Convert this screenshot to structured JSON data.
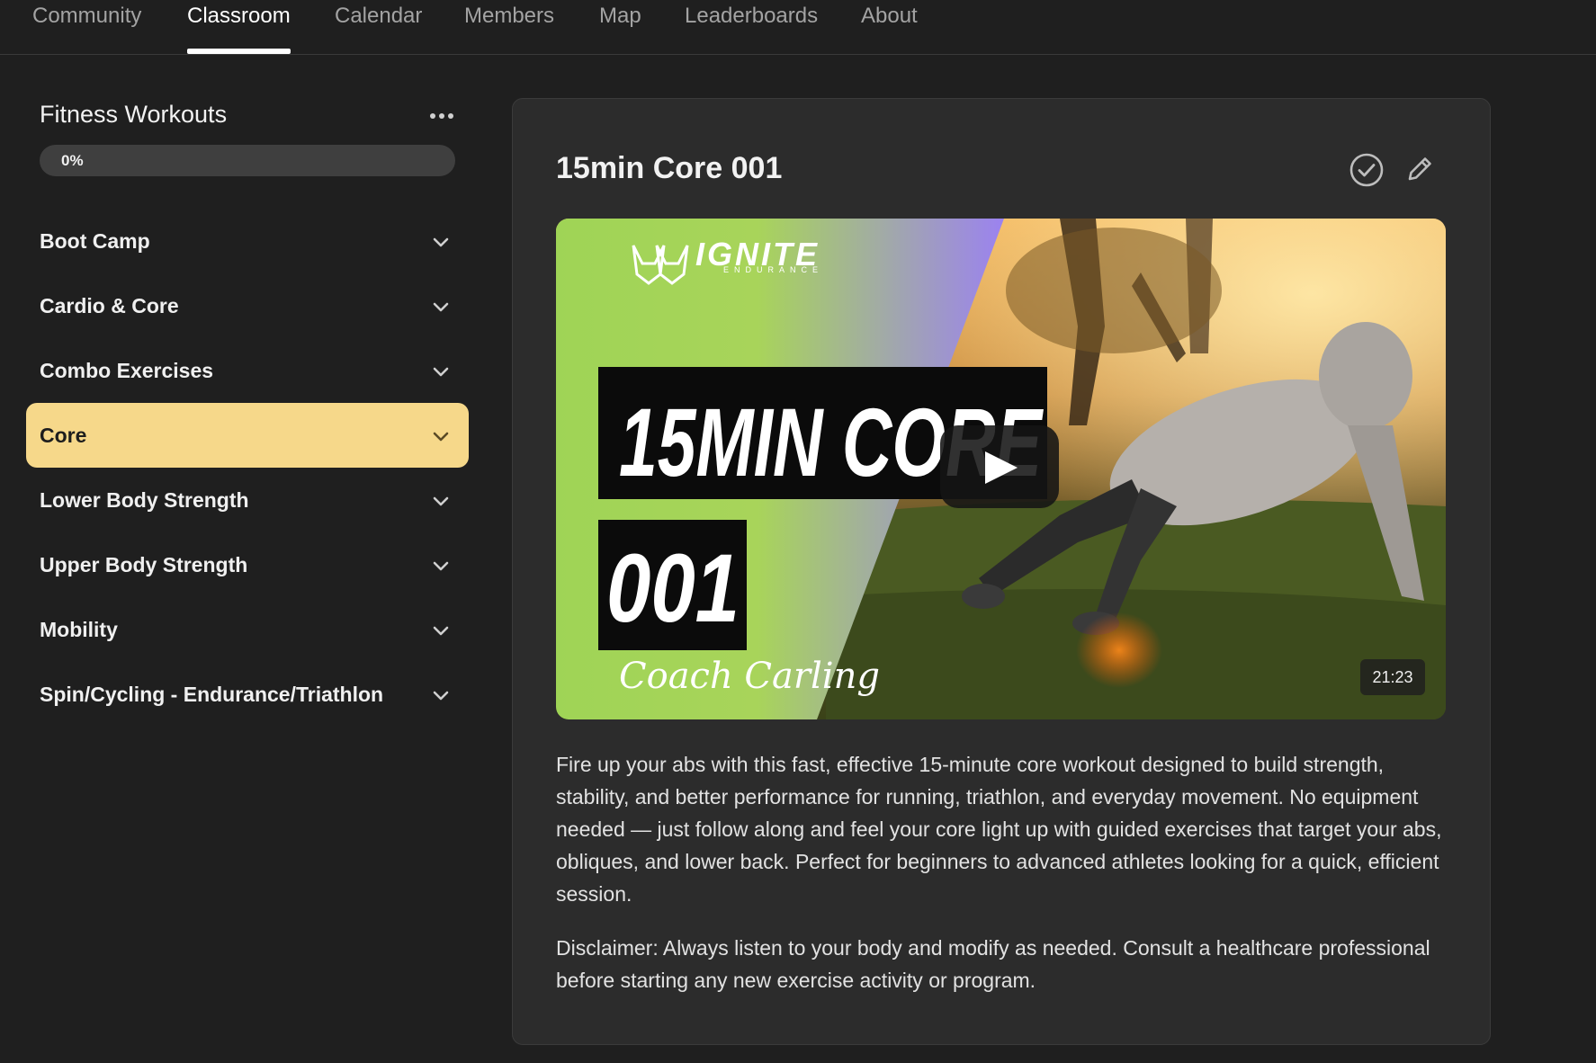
{
  "nav": {
    "tabs": [
      {
        "label": "Community",
        "active": false
      },
      {
        "label": "Classroom",
        "active": true
      },
      {
        "label": "Calendar",
        "active": false
      },
      {
        "label": "Members",
        "active": false
      },
      {
        "label": "Map",
        "active": false
      },
      {
        "label": "Leaderboards",
        "active": false
      },
      {
        "label": "About",
        "active": false
      }
    ]
  },
  "course": {
    "title": "Fitness Workouts",
    "progress_label": "0%",
    "progress_value": 0,
    "more_icon": "more-horizontal-icon"
  },
  "modules": [
    {
      "label": "Boot Camp",
      "active": false
    },
    {
      "label": "Cardio & Core",
      "active": false
    },
    {
      "label": "Combo Exercises",
      "active": false
    },
    {
      "label": "Core",
      "active": true
    },
    {
      "label": "Lower Body Strength",
      "active": false
    },
    {
      "label": "Upper Body Strength",
      "active": false
    },
    {
      "label": "Mobility",
      "active": false
    },
    {
      "label": "Spin/Cycling - Endurance/Triathlon",
      "active": false
    }
  ],
  "lesson": {
    "title": "15min Core 001",
    "check_icon": "check-circle-icon",
    "edit_icon": "pencil-icon",
    "video": {
      "brand": "IGNITE",
      "brand_sub": "ENDURANCE",
      "headline_1": "15MIN CORE",
      "headline_2": "001",
      "signature": "Coach Carling",
      "duration": "21:23"
    },
    "description": "Fire up your abs with this fast, effective 15-minute core workout designed to build strength, stability, and better performance for running, triathlon, and everyday movement. No equipment needed — just follow along and feel your core light up with guided exercises that target your abs, obliques, and lower back. Perfect for beginners to advanced athletes looking for a quick, efficient session.",
    "disclaimer": "Disclaimer: Always listen to your body and modify as needed. Consult a healthcare professional before starting any new exercise activity or program."
  },
  "colors": {
    "background": "#1f1f1f",
    "card": "#2c2c2c",
    "accent": "#f6d88a",
    "thumb_green": "#9fd456",
    "thumb_purple": "#9b82f0"
  }
}
